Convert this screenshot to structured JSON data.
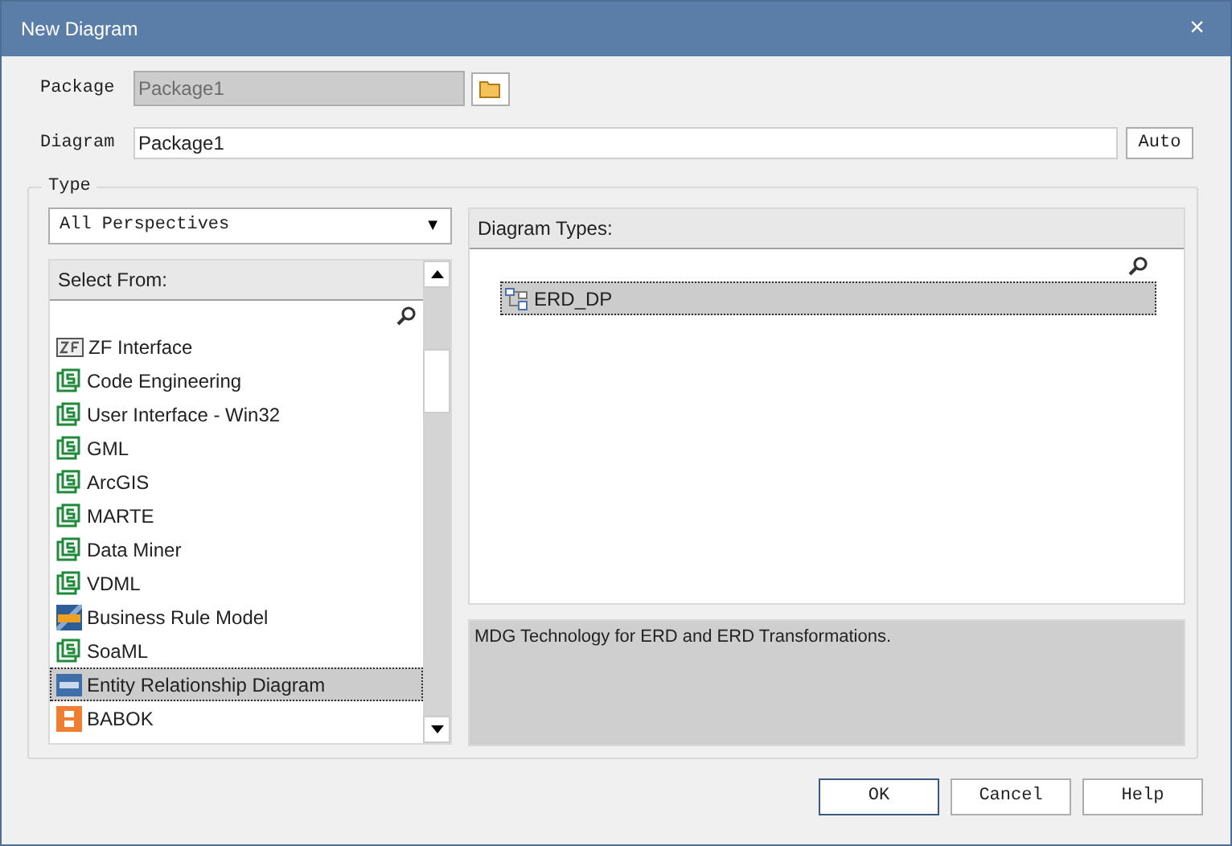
{
  "window": {
    "title": "New Diagram",
    "close": "×"
  },
  "package": {
    "label": "Package",
    "value": "Package1",
    "disabled": true
  },
  "diagram": {
    "label": "Diagram",
    "value": "Package1",
    "button": "Auto"
  },
  "type_group": {
    "label": "Type",
    "perspective": {
      "value": "All Perspectives",
      "arrow": "▼"
    },
    "select_from": {
      "header": "Select From:",
      "items": [
        {
          "kind": "zf",
          "label": "ZF Interface",
          "selected": false
        },
        {
          "kind": "mdg",
          "label": "Code Engineering",
          "selected": false
        },
        {
          "kind": "mdg",
          "label": "User Interface - Win32",
          "selected": false
        },
        {
          "kind": "mdg",
          "label": "GML",
          "selected": false
        },
        {
          "kind": "mdg",
          "label": "ArcGIS",
          "selected": false
        },
        {
          "kind": "mdg",
          "label": "MARTE",
          "selected": false
        },
        {
          "kind": "mdg",
          "label": "Data Miner",
          "selected": false
        },
        {
          "kind": "mdg",
          "label": "VDML",
          "selected": false
        },
        {
          "kind": "brm",
          "label": "Business Rule Model",
          "selected": false
        },
        {
          "kind": "mdg",
          "label": "SoaML",
          "selected": false
        },
        {
          "kind": "erd",
          "label": "Entity Relationship Diagram",
          "selected": true
        },
        {
          "kind": "babok",
          "label": "BABOK",
          "selected": false
        }
      ]
    },
    "diagram_types": {
      "header": "Diagram Types:",
      "items": [
        {
          "label": "ERD_DP",
          "selected": true
        }
      ]
    },
    "description": "MDG Technology for ERD and ERD Transformations."
  },
  "buttons": [
    "OK",
    "Cancel",
    "Help"
  ]
}
